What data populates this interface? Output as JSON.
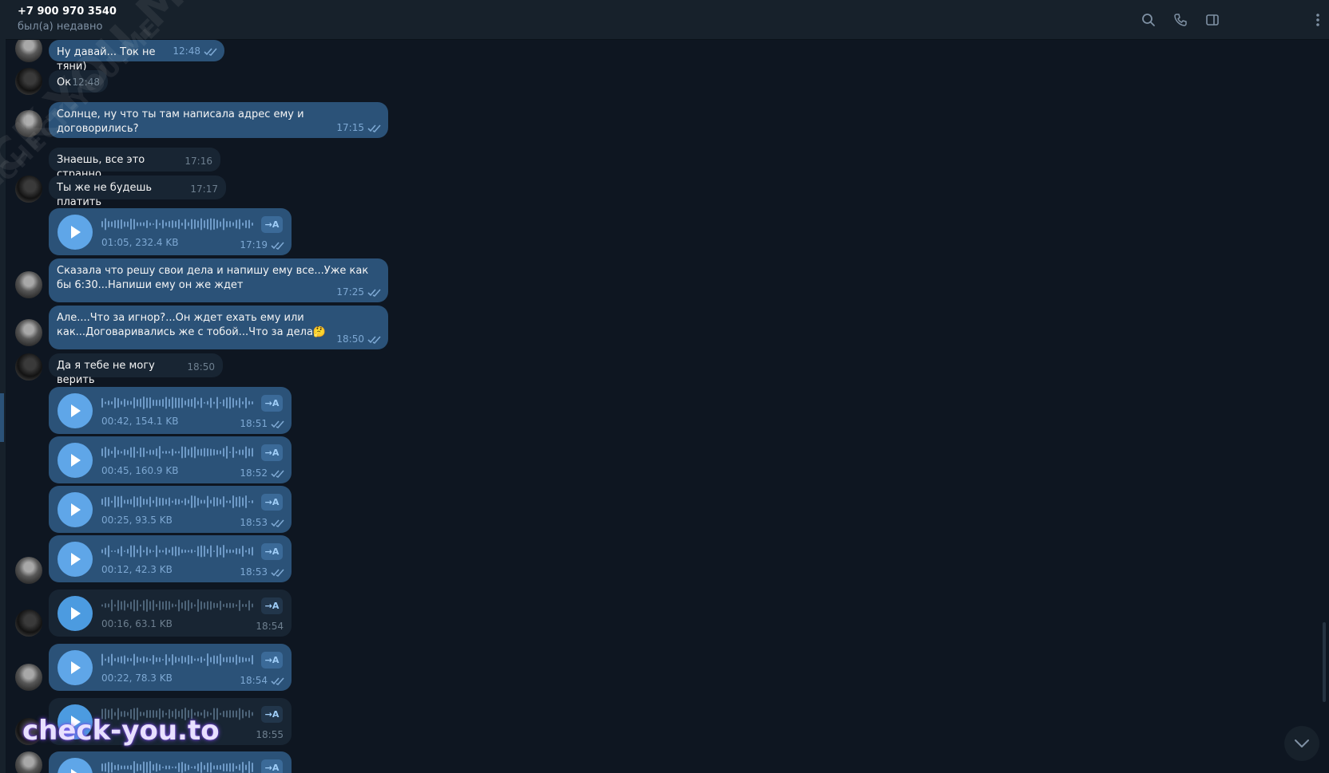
{
  "header": {
    "name": "+7 900 970 3540",
    "status": "был(а) недавно"
  },
  "messages": [
    {
      "text": "Ну давай... Ток не тяни)",
      "time": "12:48"
    },
    {
      "text": "Ок",
      "time": "12:48"
    },
    {
      "text": "Солнце, ну что ты там написала адрес ему и договорились?",
      "time": "17:15"
    },
    {
      "text": "Знаешь, все это странно",
      "time": "17:16"
    },
    {
      "text": "Ты же не будешь платить",
      "time": "17:17"
    },
    {
      "meta": "01:05, 232.4 KB",
      "time": "17:19"
    },
    {
      "text": "Сказала что решу свои дела и напишу ему все...Уже как бы 6:30...Напиши ему он же ждет",
      "time": "17:25"
    },
    {
      "text": "Але....Что за игнор?...Он ждет ехать ему или как...Договаривались же с тобой...Что за дела🤔",
      "time": "18:50"
    },
    {
      "text": "Да я тебе не могу верить",
      "time": "18:50"
    },
    {
      "meta": "00:42, 154.1 KB",
      "time": "18:51"
    },
    {
      "meta": "00:45, 160.9 KB",
      "time": "18:52"
    },
    {
      "meta": "00:25, 93.5 KB",
      "time": "18:53"
    },
    {
      "meta": "00:12, 42.3 KB",
      "time": "18:53"
    },
    {
      "meta": "00:16, 63.1 KB",
      "time": "18:54"
    },
    {
      "meta": "00:22, 78.3 KB",
      "time": "18:54"
    },
    {
      "time": "18:55"
    }
  ],
  "transcribe_label": "→A",
  "watermarks": {
    "diagonal_large": "CHECK-YOU.ME",
    "diagonal_small": "CHECK-YOU.ME",
    "bottom": "check-you.to"
  },
  "colors": {
    "background": "#0e1621",
    "header": "#17212b",
    "outgoing_bubble": "#2b5278",
    "incoming_bubble": "#182533",
    "play_button": "#5fa6e8"
  }
}
